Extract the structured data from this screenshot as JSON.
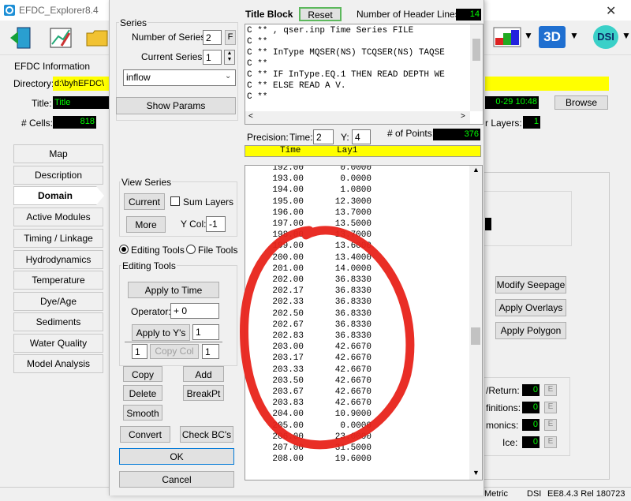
{
  "titlebar": {
    "title": "EFDC_Explorer8.4",
    "close_glyph": "✕"
  },
  "main": {
    "info_header": "EFDC Information",
    "directory_label": "Directory:",
    "directory_value": "d:\\byhEFDC\\",
    "title_label": "Title:",
    "title_value": "Title",
    "cells_label": "# Cells:",
    "cells_value": "818",
    "date_value": "0-29 10:48",
    "browse_label": "Browse",
    "layers_label": "r Layers:",
    "layers_value": "1",
    "icon_3d": "3D",
    "icon_dsi": "DSI",
    "right_buttons": [
      "Modify Seepage",
      "Apply Overlays",
      "Apply Polygon"
    ],
    "right_labels": [
      "/Return:",
      "finitions:",
      "monics:",
      "Ice:"
    ],
    "e_glyph": "E",
    "status_items": [
      "Metric",
      "DSI",
      "EE8.4.3 Rel 180723"
    ]
  },
  "sidebar": {
    "items": [
      "Map",
      "Description",
      "Domain",
      "Active Modules",
      "Timing / Linkage",
      "Hydrodynamics",
      "Temperature",
      "Dye/Age",
      "Sediments",
      "Water Quality",
      "Model Analysis"
    ],
    "active": "Domain"
  },
  "series_panel": {
    "group_label": "Series",
    "num_series_label": "Number of Series:",
    "num_series_value": "2",
    "f_button": "F",
    "current_series_label": "Current Series:",
    "current_series_value": "1",
    "series_name": "inflow",
    "show_params": "Show Params",
    "view_series_label": "View Series",
    "current_button": "Current",
    "sum_layers_label": "Sum Layers",
    "more_button": "More",
    "ycol_label": "Y Col:",
    "ycol_value": "-1",
    "editing_tools_radio": "Editing Tools",
    "file_tools_radio": "File Tools",
    "editing_group_label": "Editing Tools",
    "apply_to_time": "Apply to Time",
    "operator_label": "Operator:",
    "operator_value": "+ 0",
    "apply_to_ys": "Apply to Y's",
    "apply_to_ys_value": "1",
    "copy_col_left": "1",
    "copy_col_button": "Copy Col",
    "copy_col_right": "1",
    "copy_button": "Copy",
    "add_button": "Add",
    "delete_button": "Delete",
    "breakpt_button": "BreakPt",
    "smooth_button": "Smooth",
    "convert_button": "Convert",
    "check_bcs_button": "Check BC's",
    "ok_button": "OK",
    "cancel_button": "Cancel"
  },
  "title_block": {
    "label": "Title Block",
    "reset_button": "Reset",
    "header_lines_label": "Number of Header Lines:",
    "header_lines_value": "14",
    "lines": [
      "C ** , qser.inp Time Series FILE",
      "C **",
      "C **   InType MQSER(NS) TCQSER(NS) TAQSE",
      "C **",
      "C **   IF InType.EQ.1 THEN READ DEPTH WE",
      "C **                       ELSE READ A V.",
      "C **"
    ]
  },
  "precision": {
    "label": "Precision:",
    "time_label": "Time:",
    "time_value": "2",
    "y_label": "Y:",
    "y_value": "4",
    "points_label": "# of Points:",
    "points_value": "376"
  },
  "table": {
    "col_time": "Time",
    "col_layer": "Lay1",
    "rows": [
      [
        "192.00",
        "0.0000"
      ],
      [
        "193.00",
        "0.0000"
      ],
      [
        "194.00",
        "1.0800"
      ],
      [
        "195.00",
        "12.3000"
      ],
      [
        "196.00",
        "13.7000"
      ],
      [
        "197.00",
        "13.5000"
      ],
      [
        "198.00",
        "13.7000"
      ],
      [
        "199.00",
        "13.6000"
      ],
      [
        "200.00",
        "13.4000"
      ],
      [
        "201.00",
        "14.0000"
      ],
      [
        "202.00",
        "36.8330"
      ],
      [
        "202.17",
        "36.8330"
      ],
      [
        "202.33",
        "36.8330"
      ],
      [
        "202.50",
        "36.8330"
      ],
      [
        "202.67",
        "36.8330"
      ],
      [
        "202.83",
        "36.8330"
      ],
      [
        "203.00",
        "42.6670"
      ],
      [
        "203.17",
        "42.6670"
      ],
      [
        "203.33",
        "42.6670"
      ],
      [
        "203.50",
        "42.6670"
      ],
      [
        "203.67",
        "42.6670"
      ],
      [
        "203.83",
        "42.6670"
      ],
      [
        "204.00",
        "10.9000"
      ],
      [
        "205.00",
        "0.0000"
      ],
      [
        "206.00",
        "23.0000"
      ],
      [
        "207.00",
        "31.5000"
      ],
      [
        "208.00",
        "19.6000"
      ]
    ]
  },
  "colors": {
    "accent_yellow": "#ffff00",
    "annotation_red": "#e8231a",
    "lcd_green": "#00ff00"
  }
}
